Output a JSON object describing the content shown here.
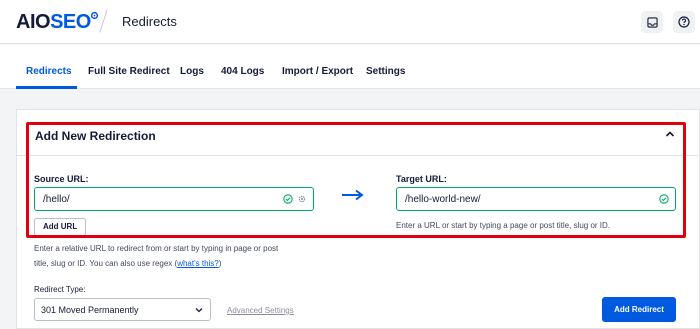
{
  "header": {
    "logo_main": "AIO",
    "logo_accent": "SEO",
    "page_title": "Redirects"
  },
  "tabs": [
    {
      "label": "Redirects",
      "active": true
    },
    {
      "label": "Full Site Redirect"
    },
    {
      "label": "Logs"
    },
    {
      "label": "404 Logs"
    },
    {
      "label": "Import / Export"
    },
    {
      "label": "Settings"
    }
  ],
  "form": {
    "title": "Add New Redirection",
    "source_label": "Source URL:",
    "source_value": "/hello/",
    "add_url_label": "Add URL",
    "source_help_part1": "Enter a relative URL to redirect from or start by typing in page or post",
    "source_help_part2": "title, slug or ID. You can also use regex (",
    "source_help_link": "what's this?",
    "source_help_part3": ")",
    "target_label": "Target URL:",
    "target_value": "/hello-world-new/",
    "target_help": "Enter a URL or start by typing a page or post title, slug or ID.",
    "redirect_type_label": "Redirect Type:",
    "redirect_type_value": "301 Moved Permanently",
    "advanced_settings_label": "Advanced Settings",
    "add_redirect_label": "Add Redirect"
  },
  "icons": {
    "inbox": "inbox-icon",
    "help": "help-icon",
    "collapse": "chevron-up-icon",
    "valid": "check-circle-icon",
    "settings": "gear-icon",
    "arrow": "arrow-right-icon",
    "dropdown": "chevron-down-icon"
  },
  "colors": {
    "accent": "#005ae0",
    "valid": "#00aa63",
    "highlight": "#e2000f"
  }
}
